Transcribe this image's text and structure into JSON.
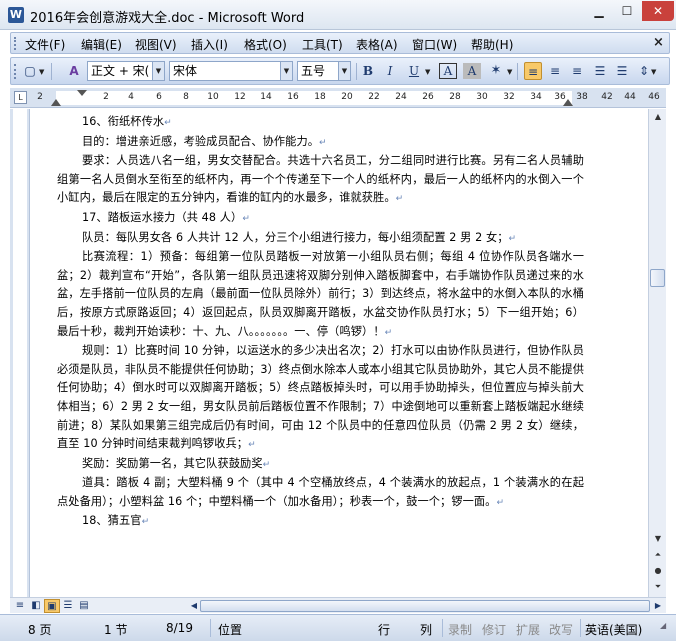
{
  "window": {
    "title": "2016年会创意游戏大全.doc - Microsoft Word",
    "app_icon_letter": "W"
  },
  "menu": [
    "文件(F)",
    "编辑(E)",
    "视图(V)",
    "插入(I)",
    "格式(O)",
    "工具(T)",
    "表格(A)",
    "窗口(W)",
    "帮助(H)"
  ],
  "toolbar": {
    "style_value": "正文 + 宋(",
    "font_value": "宋体",
    "size_value": "五号",
    "bold": "B",
    "italic": "I",
    "underline": "U",
    "char_border": "A",
    "char_shading": "A"
  },
  "ruler": [
    "2",
    "2",
    "4",
    "6",
    "8",
    "10",
    "12",
    "14",
    "16",
    "18",
    "20",
    "22",
    "24",
    "26",
    "28",
    "30",
    "32",
    "34",
    "36",
    "38",
    "42",
    "44",
    "46"
  ],
  "document": {
    "paragraphs": [
      {
        "text": "16、衔纸杯传水",
        "indent": true
      },
      {
        "text": "目的：增进亲近感，考验成员配合、协作能力。",
        "indent": true
      },
      {
        "text": "要求：人员选八名一组，男女交替配合。共选十六名员工，分二组同时进行比赛。另有二名人员辅助组第一名人员倒水至衔至的纸杯内，再一个个传递至下一个人的纸杯内，最后一人的纸杯内的水倒入一个小缸内，最后在限定的五分钟内，看谁的缸内的水最多，谁就获胜。",
        "indent": true
      },
      {
        "text": "17、踏板运水接力（共 48 人）",
        "indent": true
      },
      {
        "text": "队员：每队男女各 6 人共计 12 人，分三个小组进行接力，每小组须配置 2 男 2 女；",
        "indent": true
      },
      {
        "text": "比赛流程：1）预备：每组第一位队员踏板一对放第一小组队员右侧；每组 4 位协作队员各端水一盆；2）裁判宣布“开始”，各队第一组队员迅速将双脚分别伸入踏板脚套中，右手端协作队员递过来的水盆，左手搭前一位队员的左肩（最前面一位队员除外）前行；3）到达终点，将水盆中的水倒入本队的水桶后，按原方式原路返回；4）返回起点，队员双脚离开踏板，水盆交协作队员打水；5）下一组开始；6）最后十秒，裁判开始读秒：十、九、八。。。。。。。一、停（鸣锣）！",
        "indent": true
      },
      {
        "text": "规则：1）比赛时间 10 分钟，以运送水的多少决出名次；2）打水可以由协作队员进行，但协作队员必须是队员，非队员不能提供任何协助；3）终点倒水除本人或本小组其它队员协助外，其它人员不能提供任何协助；4）倒水时可以双脚离开踏板；5）终点踏板掉头时，可以用手协助掉头，但位置应与掉头前大体相当；6）2 男 2 女一组，男女队员前后踏板位置不作限制；7）中途倒地可以重新套上踏板端起水继续前进；8）某队如果第三组完成后仍有时间，可由 12 个队员中的任意四位队员（仍需 2 男 2 女）继续，直至 10 分钟时间结束裁判鸣锣收兵；",
        "indent": true
      },
      {
        "text": "奖励：奖励第一名，其它队获鼓励奖",
        "indent": true
      },
      {
        "text": "道具：踏板 4 副；大塑料桶 9 个（其中 4 个空桶放终点，4 个装满水的放起点，1 个装满水的在起点处备用）；小塑料盆 16 个；中塑料桶一个（加水备用）；秒表一个，鼓一个；锣一面。",
        "indent": true
      },
      {
        "text": "18、猜五官",
        "indent": true
      }
    ]
  },
  "status": {
    "page": "8 页",
    "section": "1 节",
    "page_of": "8/19",
    "position": "位置",
    "line": "行",
    "column": "列",
    "rec": "录制",
    "trk": "修订",
    "ext": "扩展",
    "ovr": "改写",
    "language": "英语(美国)"
  }
}
